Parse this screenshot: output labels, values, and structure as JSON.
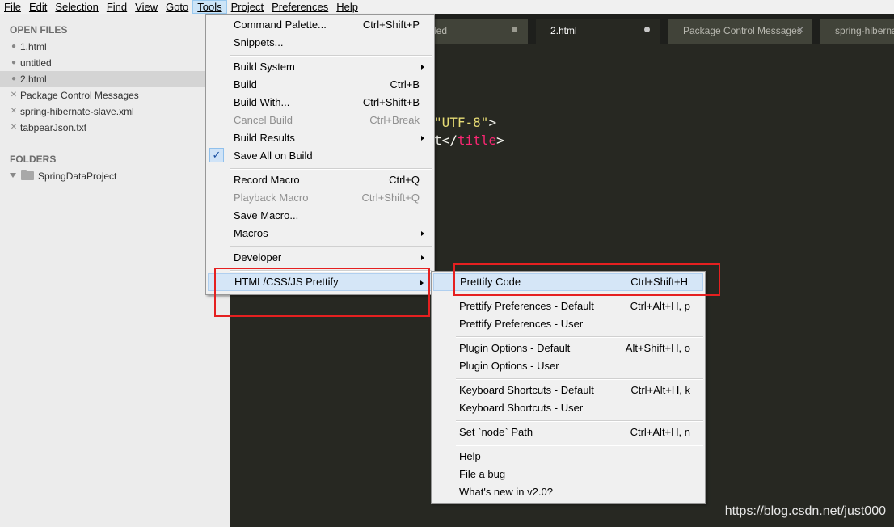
{
  "menubar": {
    "items": [
      {
        "label": "File"
      },
      {
        "label": "Edit"
      },
      {
        "label": "Selection"
      },
      {
        "label": "Find"
      },
      {
        "label": "View"
      },
      {
        "label": "Goto"
      },
      {
        "label": "Tools"
      },
      {
        "label": "Project"
      },
      {
        "label": "Preferences"
      },
      {
        "label": "Help"
      }
    ],
    "active": "Tools"
  },
  "sidebar": {
    "open_files_heading": "OPEN FILES",
    "open_files": [
      {
        "label": "1.html",
        "mark": "●"
      },
      {
        "label": "untitled",
        "mark": "●"
      },
      {
        "label": "2.html",
        "mark": "●",
        "selected": true
      },
      {
        "label": "Package Control Messages",
        "mark": "✕"
      },
      {
        "label": "spring-hibernate-slave.xml",
        "mark": "✕"
      },
      {
        "label": "tabpearJson.txt",
        "mark": "✕"
      }
    ],
    "folders_heading": "FOLDERS",
    "folders": [
      {
        "label": "SpringDataProject"
      }
    ]
  },
  "tabs": [
    {
      "label": "led",
      "state": "dot"
    },
    {
      "label": "2.html",
      "state": "dot",
      "active": true
    },
    {
      "label": "Package Control Messages",
      "state": "close"
    },
    {
      "label": "spring-hibernat",
      "state": "none"
    }
  ],
  "editor": {
    "line1_str": "\"UTF-8\"",
    "line1_plain": ">",
    "line2_plain_a": "t</",
    "line2_tag": "title",
    "line2_plain_b": ">",
    "watermark": "https://blog.csdn.net/just000"
  },
  "tools_menu": {
    "items": [
      {
        "label": "Command Palette...",
        "shortcut": "Ctrl+Shift+P"
      },
      {
        "label": "Snippets...",
        "shortcut": ""
      },
      {
        "label": "Build System",
        "shortcut": "",
        "submenu": true
      },
      {
        "label": "Build",
        "shortcut": "Ctrl+B"
      },
      {
        "label": "Build With...",
        "shortcut": "Ctrl+Shift+B"
      },
      {
        "label": "Cancel Build",
        "shortcut": "Ctrl+Break",
        "disabled": true
      },
      {
        "label": "Build Results",
        "shortcut": "",
        "submenu": true
      },
      {
        "label": "Save All on Build",
        "shortcut": "",
        "checked": true
      },
      {
        "label": "Record Macro",
        "shortcut": "Ctrl+Q"
      },
      {
        "label": "Playback Macro",
        "shortcut": "Ctrl+Shift+Q",
        "disabled": true
      },
      {
        "label": "Save Macro...",
        "shortcut": ""
      },
      {
        "label": "Macros",
        "shortcut": "",
        "submenu": true
      },
      {
        "label": "Developer",
        "shortcut": "",
        "submenu": true
      },
      {
        "label": "HTML/CSS/JS Prettify",
        "shortcut": "",
        "submenu": true,
        "highlighted": true
      }
    ],
    "check_glyph": "✓"
  },
  "prettify_menu": {
    "items": [
      {
        "label": "Prettify Code",
        "shortcut": "Ctrl+Shift+H",
        "highlighted": true
      },
      {
        "label": "Prettify Preferences - Default",
        "shortcut": "Ctrl+Alt+H, p"
      },
      {
        "label": "Prettify Preferences - User",
        "shortcut": ""
      },
      {
        "label": "Plugin Options - Default",
        "shortcut": "Alt+Shift+H, o"
      },
      {
        "label": "Plugin Options - User",
        "shortcut": ""
      },
      {
        "label": "Keyboard Shortcuts - Default",
        "shortcut": "Ctrl+Alt+H, k"
      },
      {
        "label": "Keyboard Shortcuts - User",
        "shortcut": ""
      },
      {
        "label": "Set `node` Path",
        "shortcut": "Ctrl+Alt+H, n"
      },
      {
        "label": "Help",
        "shortcut": ""
      },
      {
        "label": "File a bug",
        "shortcut": ""
      },
      {
        "label": "What's new in v2.0?",
        "shortcut": ""
      }
    ]
  },
  "colors": {
    "editor_bg": "#272822",
    "annotation_red": "#e52020",
    "menu_highlight": "#d5e6f7"
  }
}
